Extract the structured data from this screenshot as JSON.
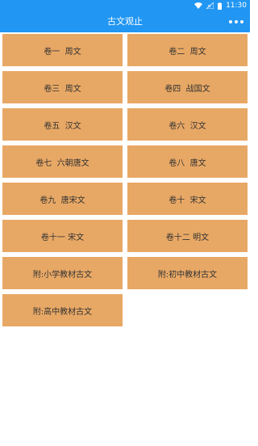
{
  "status_bar": {
    "time": "11:30",
    "icons": [
      "wifi-icon",
      "no-signal-icon",
      "battery-icon"
    ]
  },
  "app_bar": {
    "title": "古文观止",
    "more_icon": "more-dots-icon"
  },
  "volumes": [
    {
      "label": "卷一  周文"
    },
    {
      "label": "卷二  周文"
    },
    {
      "label": "卷三  周文"
    },
    {
      "label": "卷四  战国文"
    },
    {
      "label": "卷五  汉文"
    },
    {
      "label": "卷六  汉文"
    },
    {
      "label": "卷七  六朝唐文"
    },
    {
      "label": "卷八  唐文"
    },
    {
      "label": "卷九  唐宋文"
    },
    {
      "label": "卷十  宋文"
    },
    {
      "label": "卷十一 宋文"
    },
    {
      "label": "卷十二 明文"
    },
    {
      "label": "附:小学教材古文"
    },
    {
      "label": "附:初中教材古文"
    },
    {
      "label": "附:高中教材古文"
    }
  ],
  "colors": {
    "primary": "#2196f3",
    "tile": "#e8a865",
    "tile_text": "#333333"
  }
}
